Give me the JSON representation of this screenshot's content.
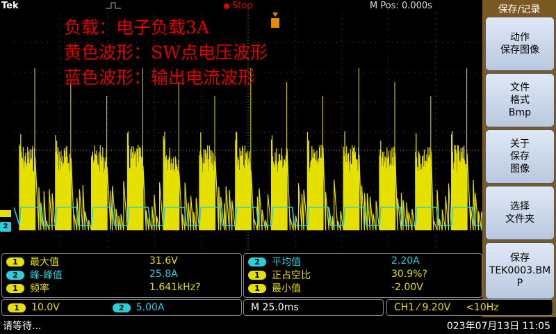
{
  "header": {
    "brand": "Tek",
    "run_state": "Stop",
    "m_pos": "M Pos: 0.000s"
  },
  "annotations": [
    "负载：电子负载3A",
    "黄色波形：SW点电压波形",
    "蓝色波形：输出电流波形"
  ],
  "channel_markers": {
    "ch2": "2"
  },
  "side_panel": {
    "title": "保存/记录",
    "buttons": [
      {
        "line1": "动作",
        "line2": "保存图像",
        "line3": ""
      },
      {
        "line1": "文件",
        "line2": "格式",
        "line3": "Bmp"
      },
      {
        "line1": "关于",
        "line2": "保存",
        "line3": "图像"
      },
      {
        "line1": "选择",
        "line2": "文件夹",
        "line3": ""
      },
      {
        "line1": "保存",
        "line2": "TEK0003.BM",
        "line3": "P"
      }
    ]
  },
  "measurements_left": [
    {
      "ch": "1",
      "name": "最大值",
      "value": "31.6V",
      "color": "#e5e000"
    },
    {
      "ch": "2",
      "name": "峰-峰值",
      "value": "25.8A",
      "color": "#2ad0d8"
    },
    {
      "ch": "1",
      "name": "频率",
      "value": "1.641kHz?",
      "color": "#e5e000"
    }
  ],
  "measurements_right": [
    {
      "ch": "2",
      "name": "平均值",
      "value": "2.20A",
      "color": "#2ad0d8"
    },
    {
      "ch": "1",
      "name": "正占空比",
      "value": "30.9%?",
      "color": "#e5e000"
    },
    {
      "ch": "1",
      "name": "最小值",
      "value": "-2.00V",
      "color": "#e5e000"
    }
  ],
  "status": {
    "ch1_scale_ch": "1",
    "ch1_scale": "10.0V",
    "ch2_scale_ch": "2",
    "ch2_scale": "5.00A",
    "timebase": "M 25.0ms",
    "trigger": "CH1 ⁄ 9.20V",
    "trigger_freq": "<10Hz"
  },
  "bottom": {
    "message": "请等待...",
    "datetime": "023年07月13日 11:05"
  },
  "colors": {
    "ch1": "#e5e000",
    "ch2": "#2ad0d8",
    "annotation": "#e00000",
    "side_panel": "#7a5a20"
  }
}
